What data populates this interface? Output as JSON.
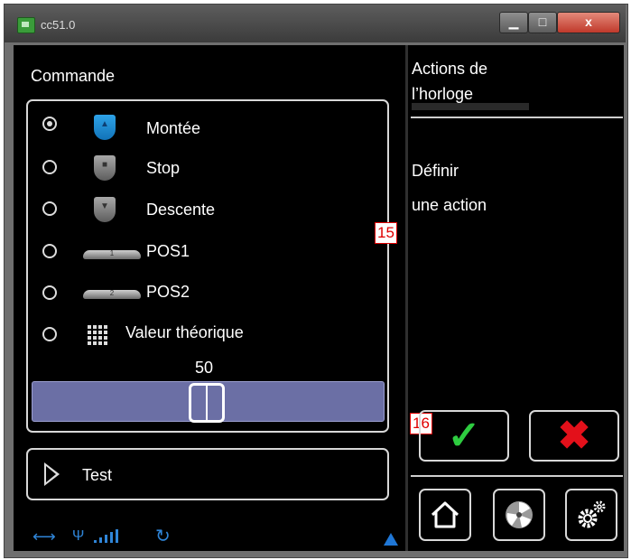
{
  "window": {
    "title": "cc51.0",
    "min_label": "▁",
    "max_label": "□",
    "close_label": "x"
  },
  "left_panel": {
    "command_label": "Commande",
    "options": [
      {
        "label": "Montée",
        "icon": "blind-up-icon",
        "selected": true
      },
      {
        "label": "Stop",
        "icon": "blind-stop-icon",
        "selected": false
      },
      {
        "label": "Descente",
        "icon": "blind-down-icon",
        "selected": false
      },
      {
        "label": "POS1",
        "icon": "pos1-icon",
        "selected": false
      },
      {
        "label": "POS2",
        "icon": "pos2-icon",
        "selected": false
      },
      {
        "label": "Valeur théorique",
        "icon": "keypad-icon",
        "selected": false
      }
    ],
    "pill_numbers": [
      "1",
      "2"
    ],
    "slider": {
      "value": 50,
      "value_label": "50",
      "min": 0,
      "max": 100
    },
    "test_label": "Test",
    "status_icons": [
      "usb-icon",
      "antenna-icon",
      "signal-bars-icon",
      "refresh-icon",
      "warning-triangle-icon"
    ]
  },
  "right_panel": {
    "title_line1": "Actions de",
    "title_line2": "l’horloge",
    "desc_line1": "Définir",
    "desc_line2": "une action",
    "ok_symbol": "✓",
    "cancel_symbol": "✖"
  },
  "annotations": {
    "badge_15": "15",
    "badge_16": "16"
  },
  "colors": {
    "accent_blue": "#1f77d6",
    "slider_fill": "#6b6fa5",
    "ok_green": "#2ecc40",
    "cancel_red": "#e3101a",
    "badge_red": "#e00000"
  }
}
